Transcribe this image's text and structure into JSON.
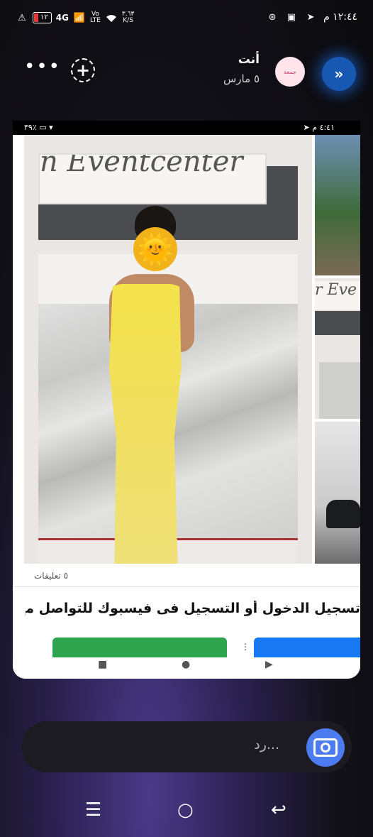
{
  "status_bar": {
    "time": "١٢:٤٤ م",
    "battery": "١٢",
    "network": "4G",
    "volte_top": "Vo",
    "volte_bottom": "LTE",
    "speed_value": "٣.٦٣",
    "speed_unit": "K/S"
  },
  "story_header": {
    "user_name": "أنت",
    "date": "٥ مارس",
    "avatar_text": "جمعة",
    "more_glyph": "•••",
    "add_glyph": "+",
    "next_glyph": "»"
  },
  "inner": {
    "status_time": "٤:٤١ م",
    "status_battery": "٣٩٪",
    "sign_text": "n Eventcenter",
    "side_sign_text": "r Eve",
    "face_emoji": "🌞",
    "comments": "٥ تعليقات",
    "login_text": "تسجيل الدخول أو التسجيل فى فيسبوك للتواصل مع الأصد...",
    "nav_back": "▶",
    "nav_home": "●",
    "nav_recent": "■"
  },
  "reply": {
    "placeholder": "رد..."
  },
  "system_nav": {
    "recent": "☰",
    "home": "○",
    "back": "↩"
  }
}
